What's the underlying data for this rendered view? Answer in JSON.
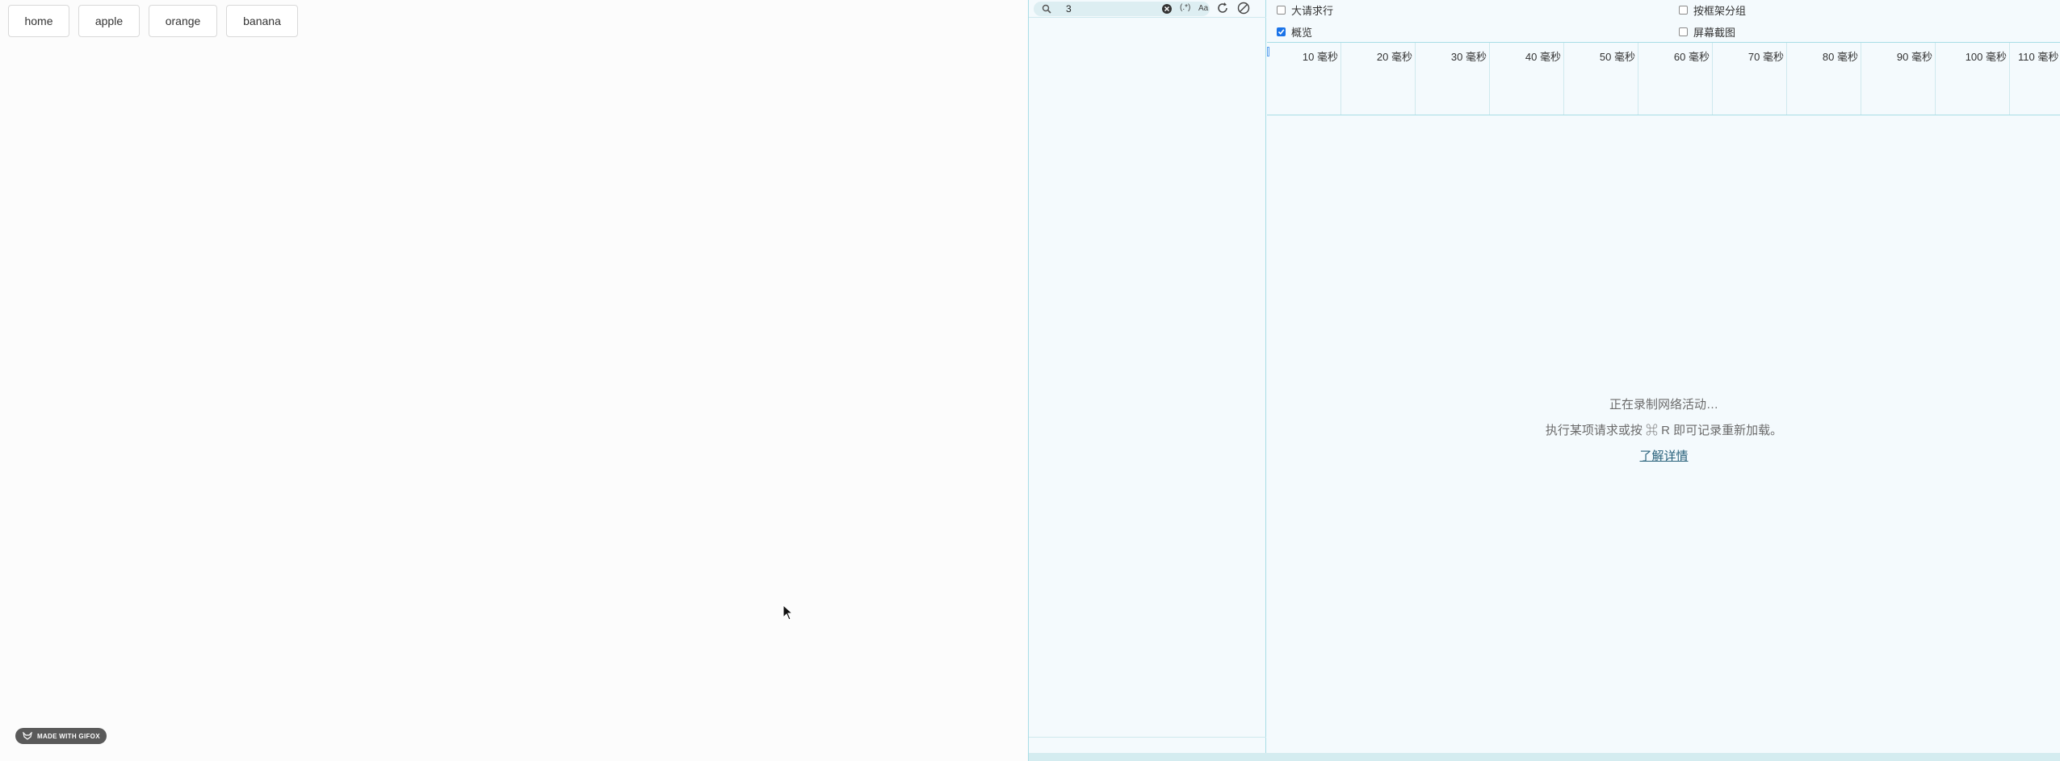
{
  "page": {
    "nav": [
      "home",
      "apple",
      "orange",
      "banana"
    ],
    "badge": "MADE WITH GIFOX"
  },
  "devtools": {
    "filter": {
      "value": "3",
      "regex_label": "(.*)",
      "case_label": "Aa"
    },
    "options": {
      "large_rows": "大请求行",
      "group_by_frame": "按框架分组",
      "overview": "概览",
      "screenshots": "屏幕截图"
    },
    "timeline_ticks": [
      "10 毫秒",
      "20 毫秒",
      "30 毫秒",
      "40 毫秒",
      "50 毫秒",
      "60 毫秒",
      "70 毫秒",
      "80 毫秒",
      "90 毫秒",
      "100 毫秒",
      "110 毫秒"
    ],
    "empty": {
      "recording": "正在录制网络活动…",
      "hint": "执行某项请求或按 ⌘ R 即可记录重新加载。",
      "learn_more": "了解详情"
    }
  }
}
